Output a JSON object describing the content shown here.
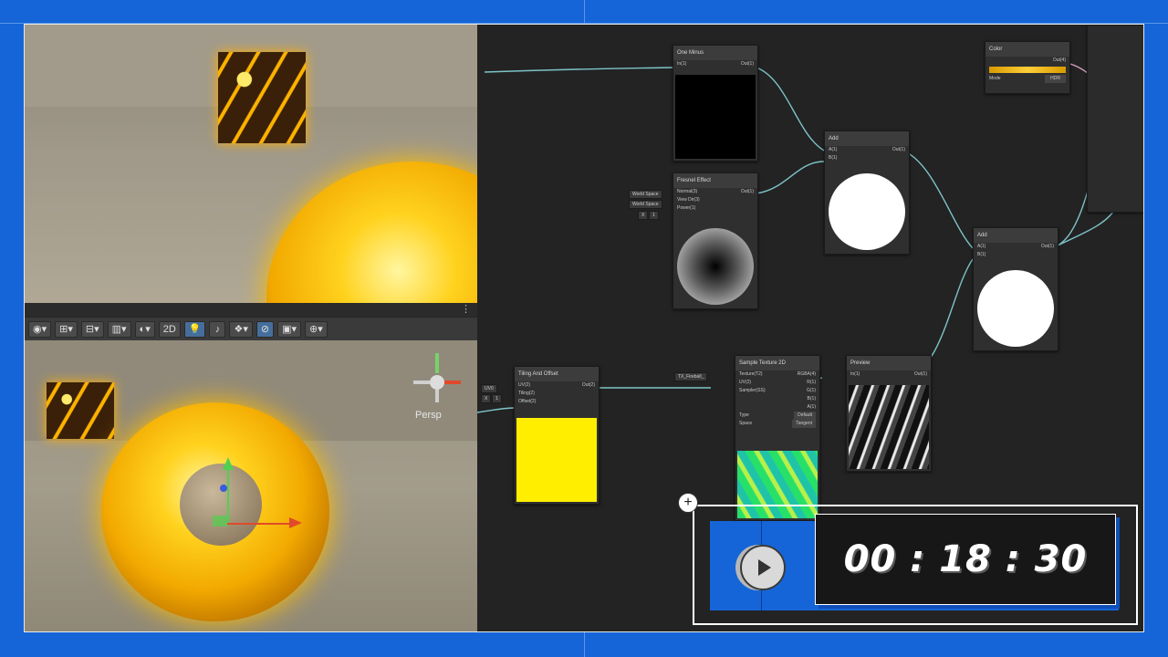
{
  "scene": {
    "persp_label": "Persp",
    "toolbar": {
      "mode_2d": "2D",
      "menu_dots": "⋮"
    }
  },
  "graph": {
    "nodes": {
      "one_minus": {
        "title": "One Minus",
        "in": "In(1)",
        "out": "Out(1)"
      },
      "fresnel": {
        "title": "Fresnel Effect",
        "normal": "Normal(3)",
        "view": "View Dir(3)",
        "power": "Power(1)",
        "out": "Out(1)",
        "chip_world1": "World Space",
        "chip_world2": "World Space",
        "chip_x": "X",
        "chip_val": "1"
      },
      "add1": {
        "title": "Add",
        "a": "A(1)",
        "b": "B(1)",
        "out": "Out(1)"
      },
      "add2": {
        "title": "Add",
        "a": "A(1)",
        "b": "B(1)",
        "out": "Out(1)"
      },
      "color": {
        "title": "Color",
        "out": "Out(4)",
        "mode_label": "Mode",
        "mode_value": "HDR"
      },
      "tiling": {
        "title": "Tiling And Offset",
        "uv": "UV(2)",
        "tiling": "Tiling(2)",
        "offset": "Offset(2)",
        "out": "Out(2)",
        "chip_uv": "UV0",
        "chip_x": "X",
        "chip_val": "1"
      },
      "sample": {
        "title": "Sample Texture 2D",
        "texture": "Texture(T2)",
        "uv": "UV(2)",
        "sampler": "Sampler(SS)",
        "rgba": "RGBA(4)",
        "r": "R(1)",
        "g": "G(1)",
        "b": "B(1)",
        "a": "A(1)",
        "type_label": "Type",
        "type_value": "Default",
        "space_label": "Space",
        "space_value": "Tangent",
        "chip_tex": "TX_Fireball_"
      },
      "preview": {
        "title": "Preview",
        "in": "In(1)",
        "out": "Out(1)"
      }
    }
  },
  "timer": {
    "text": "00 : 18 : 30",
    "plus": "+"
  },
  "colors": {
    "background": "#1565d8",
    "wire": "#7ec4c9",
    "yellow": "#ffee00"
  },
  "icons": [
    "play-icon",
    "plus-icon",
    "lightbulb-icon",
    "globe-icon",
    "camera-icon",
    "gizmo-icon"
  ]
}
